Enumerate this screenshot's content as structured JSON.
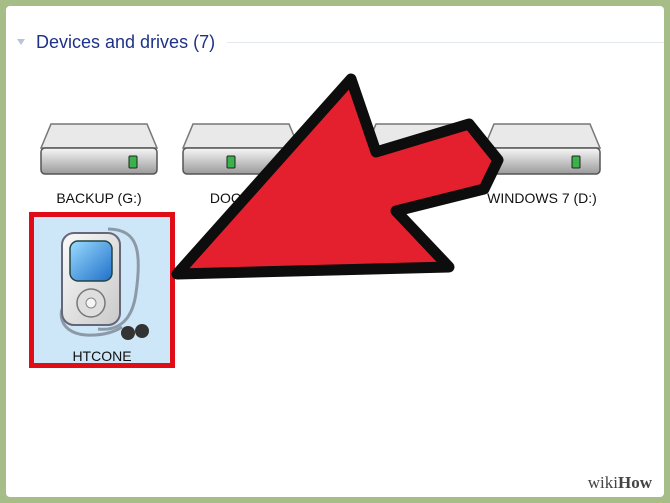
{
  "explorer": {
    "group_title": "Devices and drives (7)",
    "drives": [
      {
        "label": "BACKUP (G:)",
        "icon": "hard-drive-icon"
      },
      {
        "label": "DOCUME",
        "icon": "hard-drive-icon"
      },
      {
        "label": "",
        "icon": "hard-drive-icon"
      },
      {
        "label": "WINDOWS 7 (D:)",
        "icon": "hard-drive-icon"
      }
    ],
    "device": {
      "label": "HTCONE",
      "icon": "media-player-icon"
    }
  },
  "annotation": {
    "arrow_color": "#e5202e",
    "highlight_color": "#e10d16"
  },
  "watermark": {
    "prefix": "wiki",
    "suffix": "How"
  }
}
